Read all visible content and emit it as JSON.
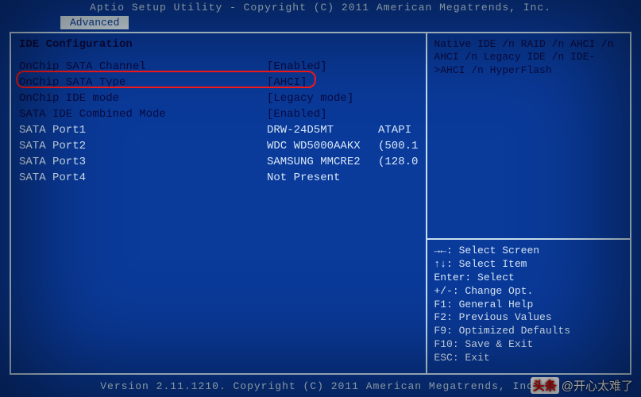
{
  "title": "Aptio Setup Utility - Copyright (C) 2011 American Megatrends, Inc.",
  "tab": {
    "label": "Advanced"
  },
  "section_title": "IDE Configuration",
  "rows": [
    {
      "label": "OnChip SATA Channel",
      "value": "[Enabled]",
      "extra": "",
      "cls": "blue-item",
      "interact": true
    },
    {
      "label": "OnChip SATA Type",
      "value": "[AHCI]",
      "extra": "",
      "cls": "blue-item",
      "interact": true
    },
    {
      "label": "OnChip IDE mode",
      "value": "[Legacy mode]",
      "extra": "",
      "cls": "blue-item",
      "interact": true
    },
    {
      "label": "SATA IDE Combined Mode",
      "value": "[Enabled]",
      "extra": "",
      "cls": "blue-item",
      "interact": true
    },
    {
      "label": "SATA Port1",
      "value": "DRW-24D5MT",
      "extra": "ATAPI",
      "cls": "white-item",
      "interact": false
    },
    {
      "label": "SATA Port2",
      "value": "WDC WD5000AAKX",
      "extra": "(500.1",
      "cls": "white-item",
      "interact": false
    },
    {
      "label": "SATA Port3",
      "value": "SAMSUNG MMCRE2",
      "extra": "(128.0",
      "cls": "white-item",
      "interact": false
    },
    {
      "label": "SATA Port4",
      "value": "Not Present",
      "extra": "",
      "cls": "white-item",
      "interact": false
    }
  ],
  "help_text": "Native IDE /n RAID /n AHCI /n AHCI /n Legacy IDE /n IDE->AHCI /n HyperFlash",
  "key_help": [
    "→←: Select Screen",
    "↑↓: Select Item",
    "Enter: Select",
    "+/-: Change Opt.",
    "F1: General Help",
    "F2: Previous Values",
    "F9: Optimized Defaults",
    "F10: Save & Exit",
    "ESC: Exit"
  ],
  "footer": "Version 2.11.1210. Copyright (C) 2011 American Megatrends, Inc.",
  "watermark": {
    "badge": "头条",
    "text": "@开心太难了"
  }
}
